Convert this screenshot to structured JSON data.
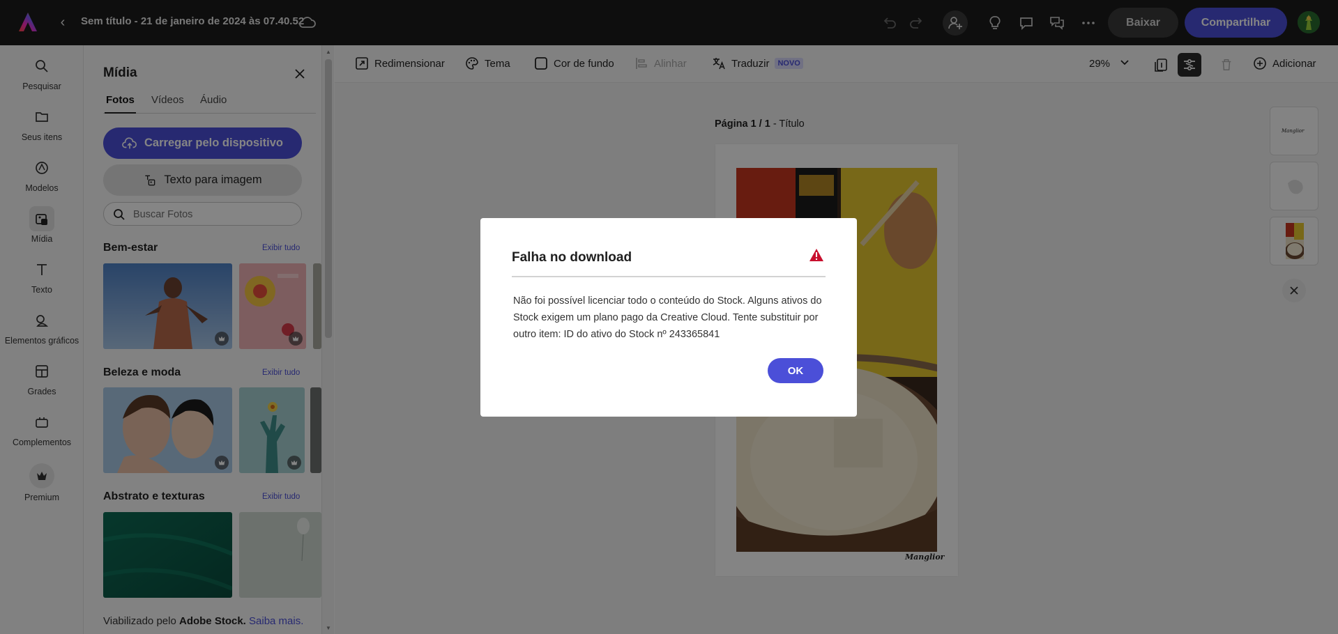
{
  "app": {
    "document_title": "Sem título - 21 de janeiro de 2024 às 07.40.52",
    "download_label": "Baixar",
    "share_label": "Compartilhar"
  },
  "rail": {
    "items": [
      {
        "label": "Pesquisar",
        "icon": "search-icon"
      },
      {
        "label": "Seus itens",
        "icon": "folder-icon"
      },
      {
        "label": "Modelos",
        "icon": "templates-icon"
      },
      {
        "label": "Mídia",
        "icon": "media-icon"
      },
      {
        "label": "Texto",
        "icon": "text-icon"
      },
      {
        "label": "Elementos gráficos",
        "icon": "shapes-icon"
      },
      {
        "label": "Grades",
        "icon": "grid-icon"
      },
      {
        "label": "Complementos",
        "icon": "addons-icon"
      },
      {
        "label": "Premium",
        "icon": "premium-crown-icon"
      }
    ],
    "active_index": 3
  },
  "panel": {
    "title": "Mídia",
    "tabs": [
      "Fotos",
      "Vídeos",
      "Áudio"
    ],
    "active_tab": "Fotos",
    "upload_label": "Carregar pelo dispositivo",
    "text_to_image_label": "Texto para imagem",
    "search_placeholder": "Buscar Fotos",
    "sections": [
      {
        "title": "Bem-estar",
        "link": "Exibir tudo"
      },
      {
        "title": "Beleza e moda",
        "link": "Exibir tudo"
      },
      {
        "title": "Abstrato e texturas",
        "link": "Exibir tudo"
      }
    ],
    "footer": {
      "prefix": "Viabilizado pelo ",
      "brand": "Adobe Stock.",
      "link": "Saiba mais."
    }
  },
  "toolbar": {
    "resize": "Redimensionar",
    "theme": "Tema",
    "background": "Cor de fundo",
    "align": "Alinhar",
    "translate": "Traduzir",
    "new_badge": "NOVO",
    "zoom": "29%",
    "add": "Adicionar"
  },
  "canvas": {
    "page_label_bold": "Página 1 / 1",
    "page_label_rest": " - Título",
    "signature": "Manglior"
  },
  "dialog": {
    "title": "Falha no download",
    "body": "Não foi possível licenciar todo o conteúdo do Stock. Alguns ativos do Stock exigem um plano pago da Creative Cloud. Tente substituir por outro item: ID do ativo do Stock nº 243365841",
    "ok": "OK"
  },
  "colors": {
    "accent": "#4b4fd8",
    "topbar": "#1c1c1c",
    "warning": "#c8102e"
  }
}
